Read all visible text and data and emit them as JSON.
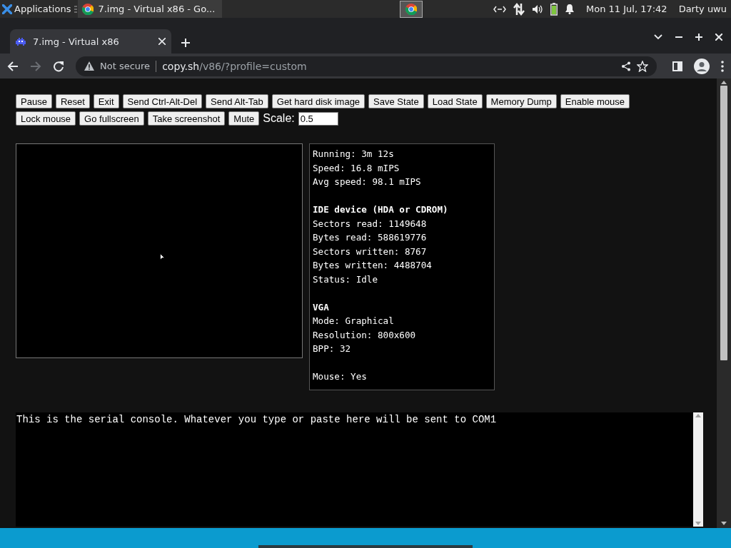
{
  "panel": {
    "menu_label": "Applications",
    "tasks": [
      {
        "title": "7.img - Virtual x86 - Go...",
        "selected": true
      }
    ],
    "clock": "Mon 11 Jul, 17:42",
    "user": "Darty uwu"
  },
  "browser": {
    "tabs": [
      {
        "title": "7.img - Virtual x86",
        "selected": true
      }
    ],
    "nav": [
      {
        "kind": "back",
        "disabled": false
      },
      {
        "kind": "forward",
        "disabled": true
      },
      {
        "kind": "reload",
        "disabled": false
      }
    ],
    "security": "Not secure",
    "url_host": "copy.sh",
    "url_path": "/v86/?profile=custom"
  },
  "toolbar": {
    "buttons": [
      "Pause",
      "Reset",
      "Exit",
      "Send Ctrl-Alt-Del",
      "Send Alt-Tab",
      "Get hard disk image",
      "Save State",
      "Load State",
      "Memory Dump",
      "Enable mouse",
      "Lock mouse",
      "Go fullscreen",
      "Take screenshot",
      "Mute"
    ],
    "scale_label": "Scale:",
    "scale_value": "0.5"
  },
  "stats": [
    {
      "lines": [
        "Running: 3m 12s",
        "Speed: 16.8 mIPS",
        "Avg speed: 98.1 mIPS"
      ]
    },
    {
      "heading": "IDE device (HDA or CDROM)",
      "lines": [
        "Sectors read: 1149648",
        "Bytes read: 588619776",
        "Sectors written: 8767",
        "Bytes written: 4488704",
        "Status: Idle"
      ]
    },
    {
      "heading": "VGA",
      "lines": [
        "Mode: Graphical",
        "Resolution: 800x600",
        "BPP: 32"
      ]
    },
    {
      "lines": [
        "Mouse: Yes"
      ]
    }
  ],
  "console": {
    "value": "This is the serial console. Whatever you type or paste here will be sent to COM1"
  }
}
